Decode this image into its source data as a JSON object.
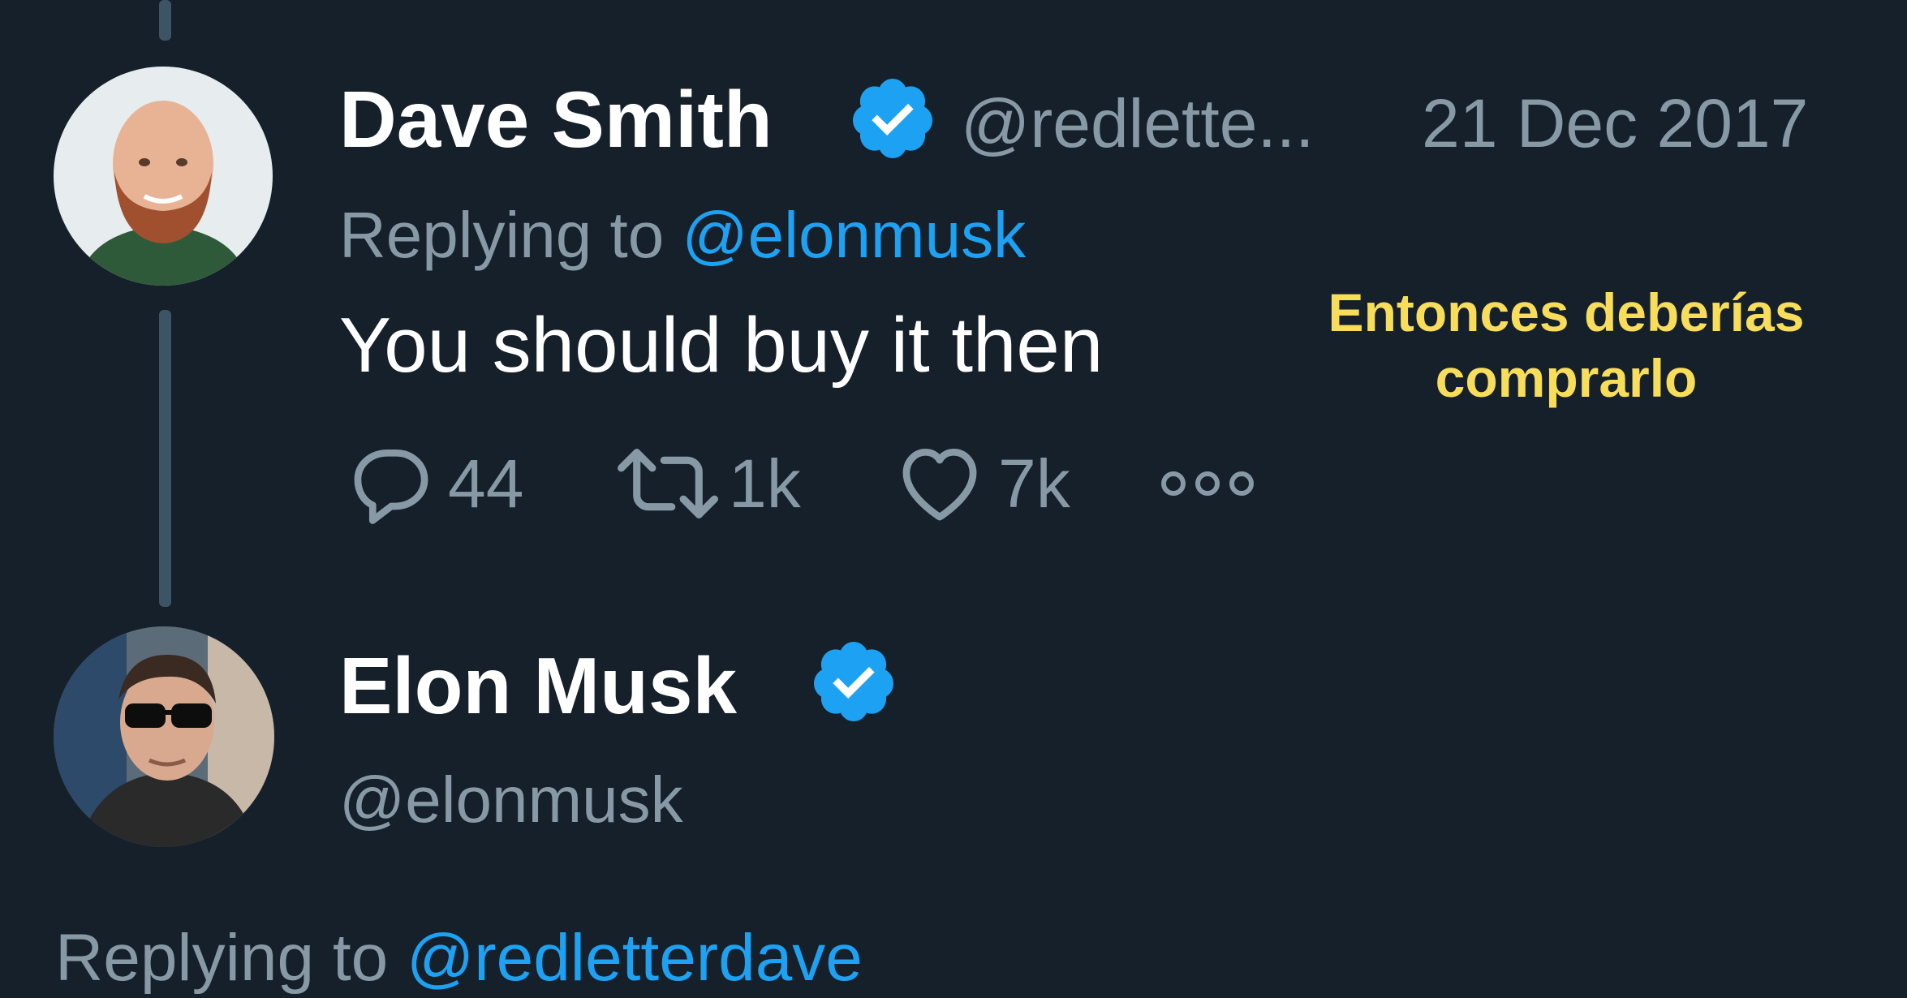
{
  "tweet1": {
    "name": "Dave Smith",
    "handle": "@redlette...",
    "date": "21 Dec 2017",
    "replying_prefix": "Replying to",
    "replying_handle": "@elonmusk",
    "text": "You should buy it then",
    "actions": {
      "replies": "44",
      "retweets": "1k",
      "likes": "7k"
    }
  },
  "translation": {
    "line1": "Entonces deberías",
    "line2": "comprarlo"
  },
  "tweet2": {
    "name": "Elon Musk",
    "handle": "@elonmusk",
    "replying_prefix": "Replying to",
    "replying_handle": "@redletterdave"
  },
  "colors": {
    "background": "#15202b",
    "verified": "#1da1f2",
    "link": "#1da1f2",
    "muted": "#8899a6",
    "overlay_text": "#f8dd5a"
  },
  "icons": [
    "verified-badge-icon",
    "reply-icon",
    "retweet-icon",
    "like-icon",
    "more-icon"
  ]
}
